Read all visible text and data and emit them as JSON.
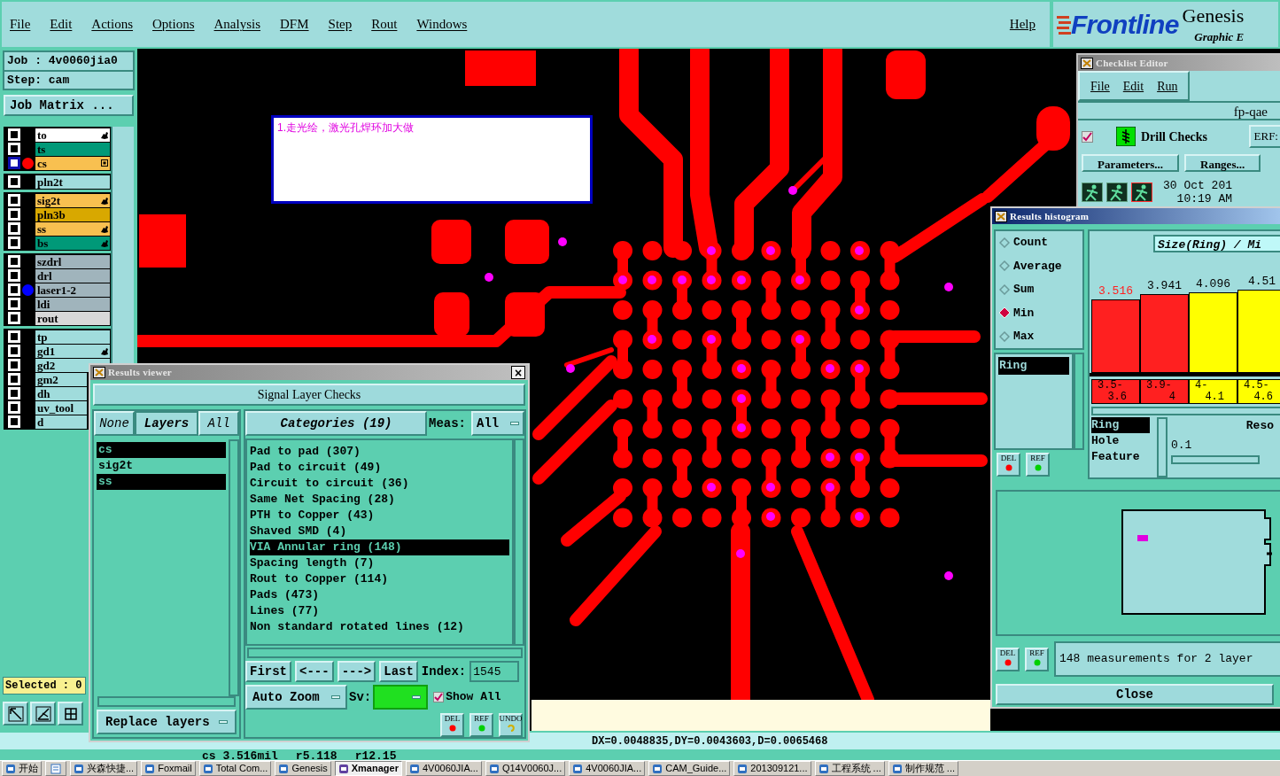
{
  "menu": {
    "items": [
      "File",
      "Edit",
      "Actions",
      "Options",
      "Analysis",
      "DFM",
      "Step",
      "Rout",
      "Windows"
    ],
    "help": "Help"
  },
  "logo": {
    "brand": "Frontline",
    "product": "Genesis",
    "subtitle": "Graphic E"
  },
  "job": {
    "job": "Job : 4v0060jia0",
    "step": "Step: cam",
    "matrix_button": "Job Matrix ..."
  },
  "layer_groups": [
    [
      {
        "name": "to",
        "color": "#ffffff",
        "kind": "hand",
        "selected": false
      },
      {
        "name": "ts",
        "color": "#009978",
        "kind": "plain",
        "selected": false
      },
      {
        "name": "cs",
        "color": "#f8c050",
        "kind": "grid",
        "marker": {
          "color": "#ff0000"
        },
        "selected": true
      }
    ],
    [
      {
        "name": "pln2t",
        "color": "#a0dcdc",
        "kind": "plain",
        "selected": false
      }
    ],
    [
      {
        "name": "sig2t",
        "color": "#f8c050",
        "kind": "hand",
        "selected": false
      },
      {
        "name": "pln3b",
        "color": "#d8a800",
        "kind": "plain",
        "selected": false
      },
      {
        "name": "ss",
        "color": "#f8c050",
        "kind": "hand",
        "selected": false
      },
      {
        "name": "bs",
        "color": "#009978",
        "kind": "hand",
        "selected": false
      }
    ],
    [
      {
        "name": "szdrl",
        "color": "#a0b4bc",
        "kind": "plain",
        "selected": false
      },
      {
        "name": "drl",
        "color": "#a0b4bc",
        "kind": "plain",
        "selected": false
      },
      {
        "name": "laser1-2",
        "color": "#a0b4bc",
        "kind": "plain",
        "marker": {
          "color": "#0000ff"
        },
        "selected": false
      },
      {
        "name": "ldi",
        "color": "#a0b4bc",
        "kind": "plain",
        "selected": false
      },
      {
        "name": "rout",
        "color": "#d8d8d8",
        "kind": "plain",
        "selected": false
      }
    ],
    [
      {
        "name": "tp",
        "color": "#a0dcdc",
        "kind": "plain",
        "selected": false
      },
      {
        "name": "gd1",
        "color": "#a0dcdc",
        "kind": "hand",
        "selected": false
      },
      {
        "name": "gd2",
        "color": "#a0dcdc",
        "kind": "plain",
        "selected": false
      },
      {
        "name": "gm2",
        "color": "#a0dcdc",
        "kind": "plain",
        "selected": false
      },
      {
        "name": "dh",
        "color": "#a0dcdc",
        "kind": "plain",
        "selected": false
      },
      {
        "name": "uv_tool",
        "color": "#a0dcdc",
        "kind": "plain",
        "selected": false
      },
      {
        "name": "d",
        "color": "#a0dcdc",
        "kind": "plain",
        "selected": false
      }
    ]
  ],
  "selected_count": "Selected : 0",
  "note": "1.走光绘，激光孔焊环加大做",
  "status": {
    "coords": "DX=0.0048835,DY=0.0043603,D=0.0065468",
    "measure": [
      "cs 3.516mil",
      "r5.118",
      "r12.15"
    ]
  },
  "results_viewer": {
    "title": "Results viewer",
    "close_glyph": "×",
    "header": "Signal Layer Checks",
    "layer_buttons": [
      "None",
      "Layers",
      "All"
    ],
    "layers": [
      {
        "name": "cs",
        "selected": true
      },
      {
        "name": "sig2t",
        "selected": false
      },
      {
        "name": "ss",
        "selected": true
      }
    ],
    "categories_button": "Categories (19)",
    "meas_label": "Meas:",
    "meas_value": "All",
    "categories": [
      {
        "label": "Pad to pad (307)",
        "selected": false
      },
      {
        "label": "Pad to circuit (49)",
        "selected": false
      },
      {
        "label": "Circuit to circuit (36)",
        "selected": false
      },
      {
        "label": "Same Net Spacing (28)",
        "selected": false
      },
      {
        "label": "PTH to Copper (43)",
        "selected": false
      },
      {
        "label": "Shaved SMD (4)",
        "selected": false
      },
      {
        "label": "VIA Annular ring (148)",
        "selected": true
      },
      {
        "label": "Spacing length (7)",
        "selected": false
      },
      {
        "label": "Rout to Copper (114)",
        "selected": false
      },
      {
        "label": "Pads (473)",
        "selected": false
      },
      {
        "label": "Lines (77)",
        "selected": false
      },
      {
        "label": "Non standard rotated lines (12)",
        "selected": false
      }
    ],
    "nav_buttons": [
      "First",
      "<---",
      "--->",
      "Last"
    ],
    "index_label": "Index:",
    "index_value": "1545",
    "auto_zoom": "Auto Zoom",
    "sv_label": "Sv:",
    "show_all": {
      "label": "Show All",
      "checked": true
    },
    "replace_layers": "Replace layers",
    "tools": [
      "DEL",
      "REF",
      "UNDO"
    ]
  },
  "checklist_editor": {
    "title": "Checklist Editor",
    "menu": [
      "File",
      "Edit",
      "Run"
    ],
    "name": "fp-qae",
    "check": {
      "label": "Drill Checks",
      "checked": true
    },
    "erf": "ERF:",
    "buttons": [
      "Parameters...",
      "Ranges..."
    ],
    "date": "30 Oct 201",
    "time": "10:19 AM"
  },
  "histogram": {
    "title": "Results histogram",
    "modes": [
      {
        "label": "Count",
        "selected": false
      },
      {
        "label": "Average",
        "selected": false
      },
      {
        "label": "Sum",
        "selected": false
      },
      {
        "label": "Min",
        "selected": true
      },
      {
        "label": "Max",
        "selected": false
      }
    ],
    "list": [
      {
        "label": "Ring",
        "selected": true
      }
    ],
    "list_tools": [
      "DEL",
      "REF"
    ],
    "chart_title": "Size(Ring) / Mi",
    "bars": [
      {
        "label": "3.516",
        "range": [
          "3.5-",
          "3.6"
        ],
        "color": "#ff2020",
        "selected": true
      },
      {
        "label": "3.941",
        "range": [
          "3.9-",
          "4"
        ],
        "color": "#ff2020",
        "selected": false
      },
      {
        "label": "4.096",
        "range": [
          "4-",
          "4.1"
        ],
        "color": "#ffff00",
        "selected": false
      },
      {
        "label": "4.51",
        "range": [
          "4.5-",
          "4.6"
        ],
        "color": "#ffff00",
        "selected": false
      }
    ],
    "fields": [
      {
        "label": "Ring",
        "selected": true
      },
      {
        "label": "Hole",
        "selected": false
      },
      {
        "label": "Feature",
        "selected": false
      }
    ],
    "resolution_label": "Reso",
    "resolution_value": "0.1",
    "message_tools": [
      "DEL",
      "REF"
    ],
    "message": "148 measurements for 2 layer",
    "close": "Close"
  },
  "taskbar": [
    {
      "label": "开始",
      "active": false
    },
    {
      "label": "兴森快捷...",
      "active": false
    },
    {
      "label": "Foxmail",
      "active": false
    },
    {
      "label": "Total Com...",
      "active": false
    },
    {
      "label": "Genesis",
      "active": false
    },
    {
      "label": "Xmanager",
      "active": true
    },
    {
      "label": "4V0060JIA...",
      "active": false
    },
    {
      "label": "Q14V0060J...",
      "active": false
    },
    {
      "label": "4V0060JIA...",
      "active": false
    },
    {
      "label": "CAM_Guide...",
      "active": false
    },
    {
      "label": "201309121...",
      "active": false
    },
    {
      "label": "工程系统 ...",
      "active": false
    },
    {
      "label": "制作规范 ...",
      "active": false
    }
  ]
}
